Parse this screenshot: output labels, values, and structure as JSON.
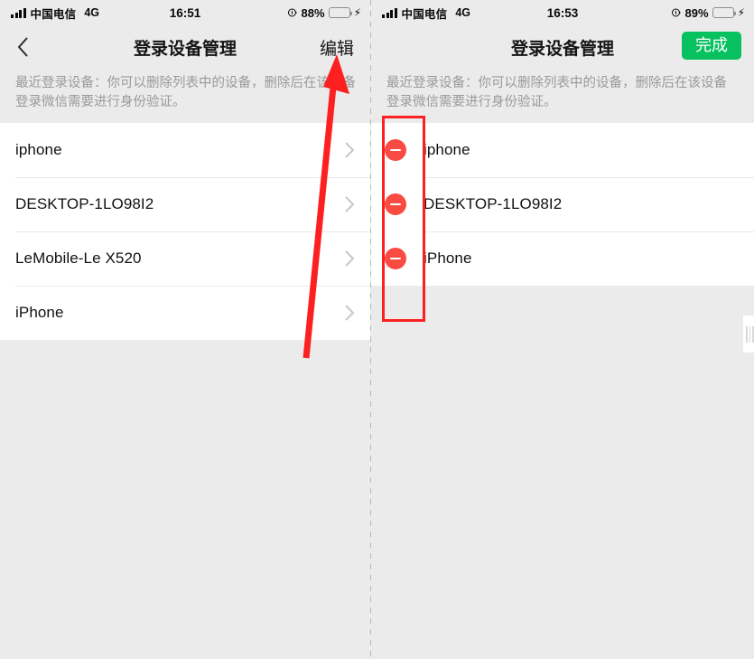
{
  "left_screen": {
    "status_bar": {
      "carrier": "中国电信",
      "network": "4G",
      "time": "16:51",
      "battery_percent": "88%",
      "signal_icon": "signal-bars-icon",
      "lock_icon": "rotation-lock-icon",
      "battery_icon": "battery-icon",
      "charging_icon": "lightning-bolt-icon"
    },
    "nav": {
      "back_icon": "chevron-left-icon",
      "title": "登录设备管理",
      "action_label": "编辑"
    },
    "description": "最近登录设备：你可以删除列表中的设备，删除后在该设备登录微信需要进行身份验证。",
    "devices": [
      {
        "name": "iphone",
        "chevron_icon": "chevron-right-icon"
      },
      {
        "name": "DESKTOP-1LO98I2",
        "chevron_icon": "chevron-right-icon"
      },
      {
        "name": "LeMobile-Le X520",
        "chevron_icon": "chevron-right-icon"
      },
      {
        "name": "iPhone",
        "chevron_icon": "chevron-right-icon"
      }
    ]
  },
  "right_screen": {
    "status_bar": {
      "carrier": "中国电信",
      "network": "4G",
      "time": "16:53",
      "battery_percent": "89%",
      "signal_icon": "signal-bars-icon",
      "lock_icon": "rotation-lock-icon",
      "battery_icon": "battery-icon",
      "charging_icon": "lightning-bolt-icon"
    },
    "nav": {
      "title": "登录设备管理",
      "action_label": "完成"
    },
    "description": "最近登录设备：你可以删除列表中的设备，删除后在该设备登录微信需要进行身份验证。",
    "devices": [
      {
        "name": "iphone",
        "delete_icon": "minus-circle-icon"
      },
      {
        "name": "DESKTOP-1LO98I2",
        "delete_icon": "minus-circle-icon"
      },
      {
        "name": "iPhone",
        "delete_icon": "minus-circle-icon"
      }
    ]
  },
  "annotations": {
    "arrow": {
      "icon": "red-arrow-up-icon",
      "color": "#fd2020"
    },
    "highlight_box": {
      "icon": "red-rectangle-highlight",
      "color": "#fd2020"
    }
  },
  "colors": {
    "accent_green": "#07c160",
    "delete_red": "#fa4b42",
    "annotation_red": "#fd2020",
    "page_background": "#ebebeb",
    "list_background": "#ffffff"
  }
}
